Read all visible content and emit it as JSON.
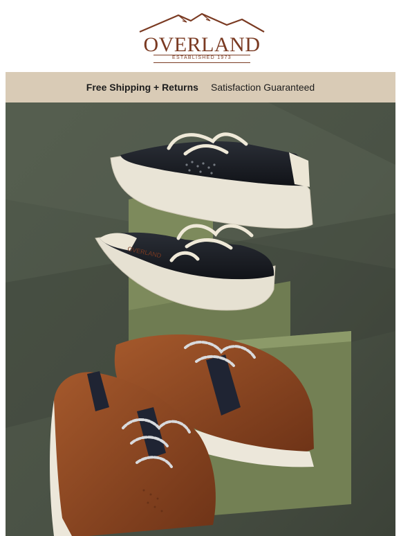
{
  "logo": {
    "name": "OVERLAND",
    "tagline": "ESTABLISHED 1973"
  },
  "promo": {
    "shipping": "Free Shipping + Returns",
    "guarantee": "Satisfaction Guaranteed"
  },
  "hero": {
    "heel_text": "OVERLAND",
    "image_description_colors": {
      "background": "#4a5245",
      "block": "#7d8a5c",
      "black_leather": "#16191f",
      "cognac_leather": "#8c4420",
      "sole": "#e8e4d8"
    }
  }
}
